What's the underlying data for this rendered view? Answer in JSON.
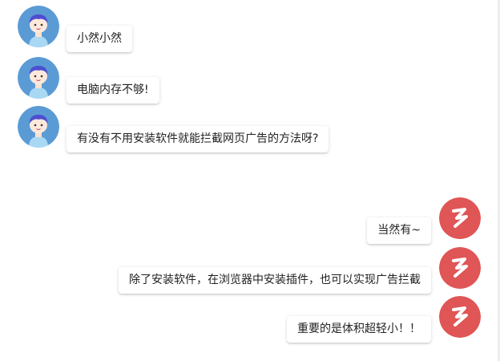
{
  "messages": [
    {
      "side": "left",
      "sender": "user",
      "avatar_icon": "boy-avatar-icon",
      "text": "小然小然"
    },
    {
      "side": "left",
      "sender": "user",
      "avatar_icon": "boy-avatar-icon",
      "text": "电脑内存不够!"
    },
    {
      "side": "left",
      "sender": "user",
      "avatar_icon": "boy-avatar-icon",
      "text": "有没有不用安装软件就能拦截网页广告的方法呀?"
    },
    {
      "side": "right",
      "sender": "assistant",
      "avatar_icon": "red-logo-avatar-icon",
      "text": "当然有~"
    },
    {
      "side": "right",
      "sender": "assistant",
      "avatar_icon": "red-logo-avatar-icon",
      "text": "除了安装软件，在浏览器中安装插件，也可以实现广告拦截"
    },
    {
      "side": "right",
      "sender": "assistant",
      "avatar_icon": "red-logo-avatar-icon",
      "text": "重要的是体积超轻小！！"
    }
  ],
  "colors": {
    "user_avatar_bg": "#5b9bd5",
    "assistant_avatar_bg": "#e05555",
    "bubble_bg": "#ffffff",
    "text": "#222222"
  }
}
